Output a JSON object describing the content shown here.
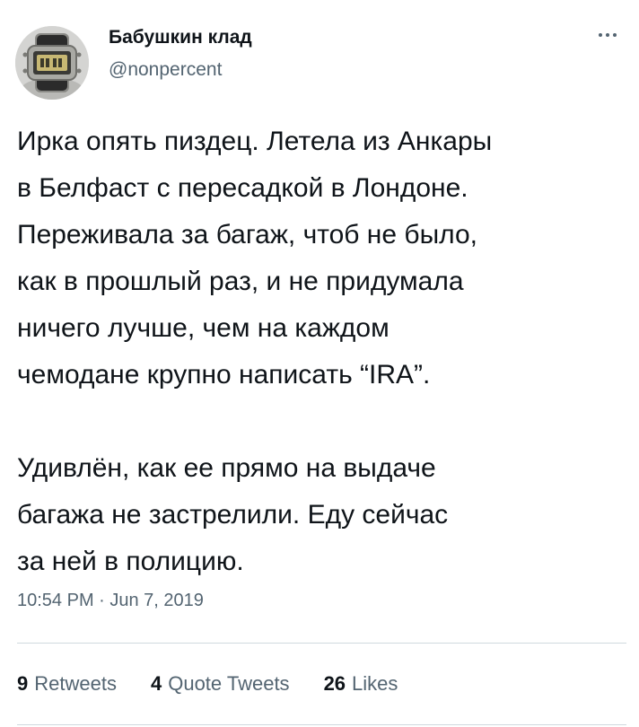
{
  "author": {
    "display_name": "Бабушкин клад",
    "handle": "@nonpercent",
    "avatar_icon": "vintage-digital-watch-avatar"
  },
  "more_icon": "more-horizontal-icon",
  "tweet": {
    "paragraph_1": "Ирка опять пиздец. Летела из Анкары\nв Белфаст с пересадкой в Лондоне.\nПереживала за багаж, чтоб не было,\nкак в прошлый раз, и не придумала\nничего лучше, чем на каждом\nчемодане крупно написать “IRA”.",
    "paragraph_2": "Удивлён, как ее прямо на выдаче\nбагажа не застрелили. Еду сейчас\nза ней в полицию."
  },
  "timestamp": "10:54 PM · Jun 7, 2019",
  "stats": {
    "retweets": {
      "count": "9",
      "label": "Retweets"
    },
    "quote_tweets": {
      "count": "4",
      "label": "Quote Tweets"
    },
    "likes": {
      "count": "26",
      "label": "Likes"
    }
  },
  "colors": {
    "text_primary": "#0f1419",
    "text_secondary": "#536471",
    "divider": "#cfd9de",
    "background": "#ffffff"
  }
}
